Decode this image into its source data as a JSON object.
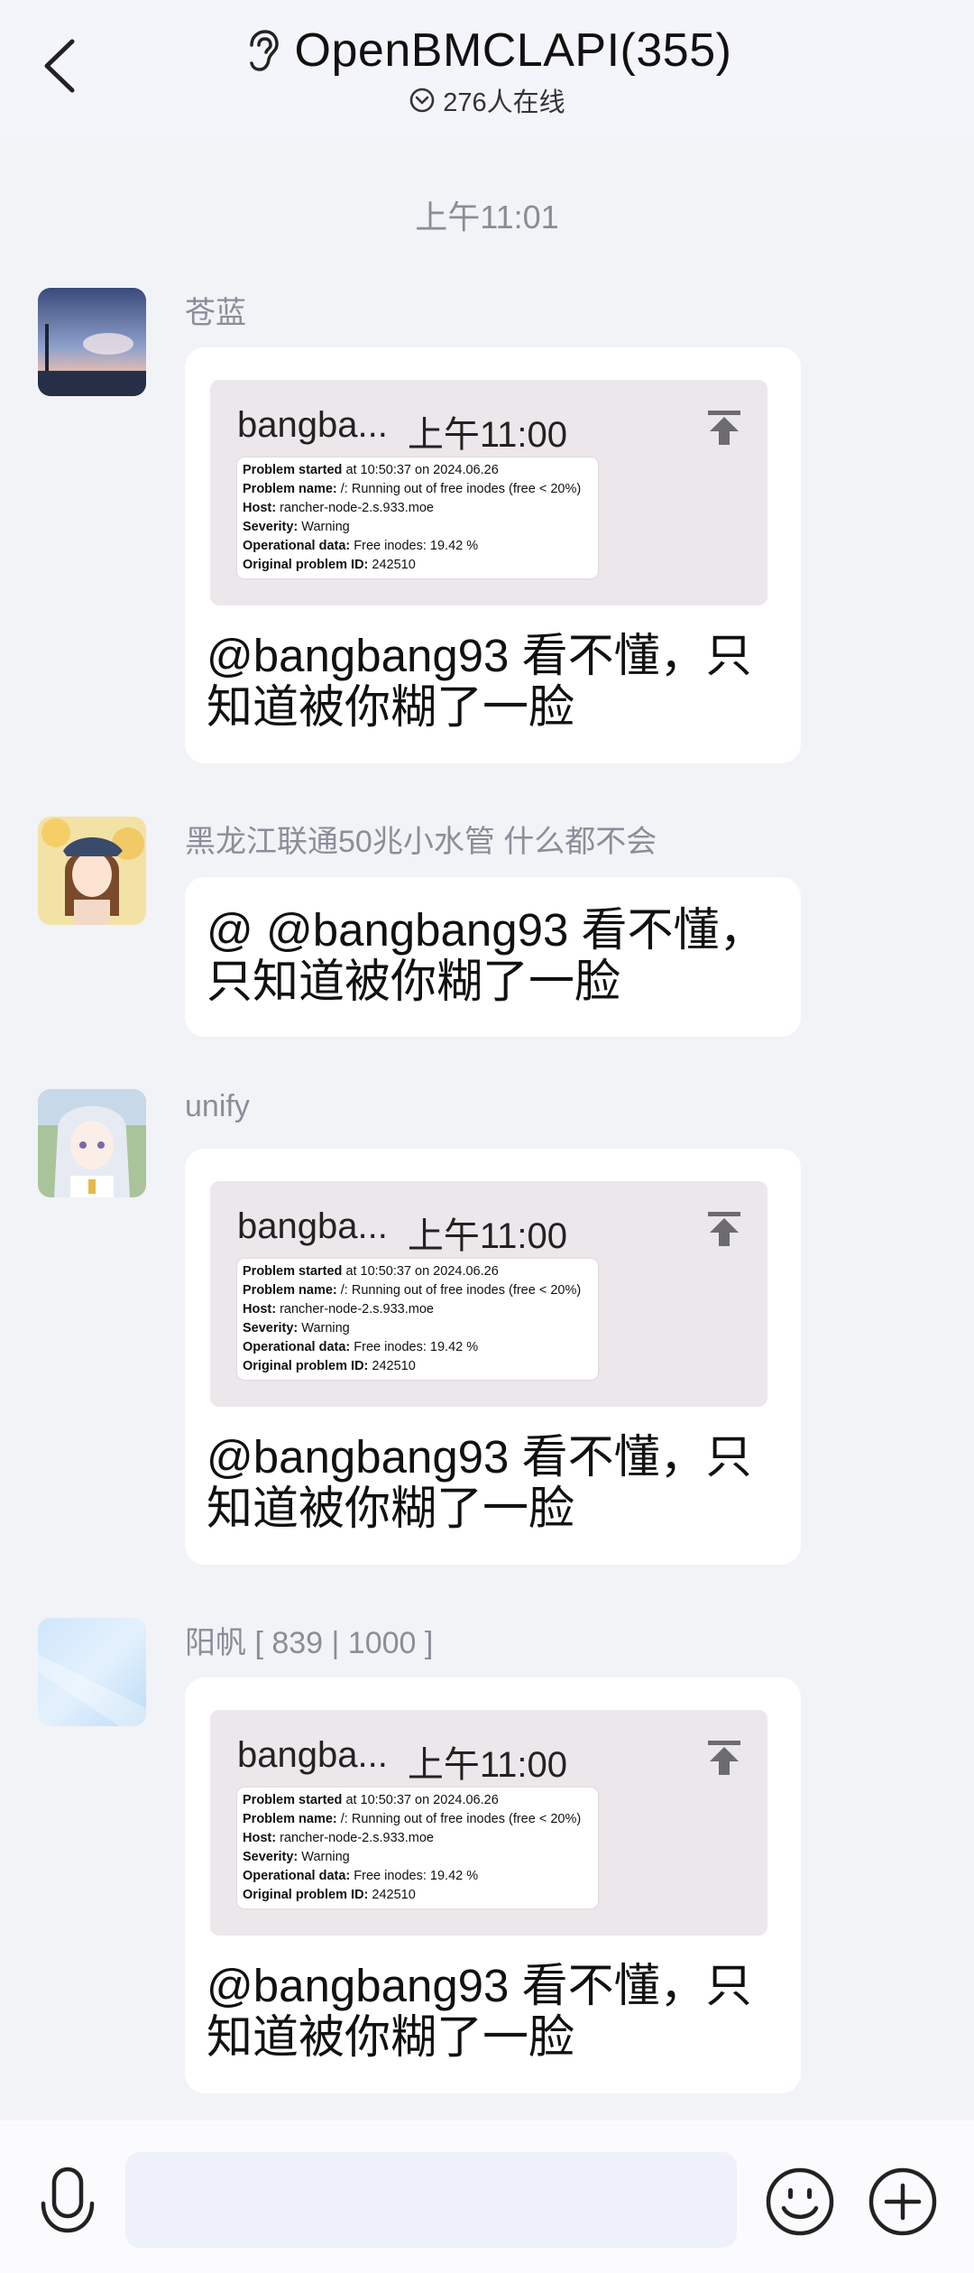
{
  "header": {
    "title": "OpenBMCLAPI(355)",
    "subtitle": "276人在线",
    "icons": [
      "back-icon",
      "ear-icon",
      "online-check-icon"
    ]
  },
  "chat": {
    "time_divider": "上午11:01",
    "messages": [
      {
        "sender": "苍蓝",
        "quote": {
          "author": "bangba...",
          "time": "上午11:00",
          "image_lines": [
            {
              "label": "Problem started",
              "value": "at 10:50:37 on 2024.06.26"
            },
            {
              "label": "Problem name:",
              "value": "/: Running out of free inodes (free < 20%)"
            },
            {
              "label": "Host:",
              "value": "rancher-node-2.s.933.moe"
            },
            {
              "label": "Severity:",
              "value": "Warning"
            },
            {
              "label": "Operational data:",
              "value": "Free inodes: 19.42 %"
            },
            {
              "label": "Original problem ID:",
              "value": "242510"
            }
          ]
        },
        "text": "@bangbang93 看不懂，只知道被你糊了一脸"
      },
      {
        "sender": "黑龙江联通50兆小水管 什么都不会",
        "text": "@ @bangbang93 看不懂，只知道被你糊了一脸"
      },
      {
        "sender": "unify",
        "quote": {
          "author": "bangba...",
          "time": "上午11:00",
          "image_lines": [
            {
              "label": "Problem started",
              "value": "at 10:50:37 on 2024.06.26"
            },
            {
              "label": "Problem name:",
              "value": "/: Running out of free inodes (free < 20%)"
            },
            {
              "label": "Host:",
              "value": "rancher-node-2.s.933.moe"
            },
            {
              "label": "Severity:",
              "value": "Warning"
            },
            {
              "label": "Operational data:",
              "value": "Free inodes: 19.42 %"
            },
            {
              "label": "Original problem ID:",
              "value": "242510"
            }
          ]
        },
        "text": "@bangbang93 看不懂，只知道被你糊了一脸"
      },
      {
        "sender": "阳帆 [ 839 | 1000 ]",
        "quote": {
          "author": "bangba...",
          "time": "上午11:00",
          "image_lines": [
            {
              "label": "Problem started",
              "value": "at 10:50:37 on 2024.06.26"
            },
            {
              "label": "Problem name:",
              "value": "/: Running out of free inodes (free < 20%)"
            },
            {
              "label": "Host:",
              "value": "rancher-node-2.s.933.moe"
            },
            {
              "label": "Severity:",
              "value": "Warning"
            },
            {
              "label": "Operational data:",
              "value": "Free inodes: 19.42 %"
            },
            {
              "label": "Original problem ID:",
              "value": "242510"
            }
          ]
        },
        "text": "@bangbang93 看不懂，只知道被你糊了一脸"
      }
    ]
  },
  "input_bar": {
    "value": "",
    "icons": [
      "microphone-icon",
      "emoji-icon",
      "plus-icon"
    ]
  },
  "colors": {
    "background": "#f2f3f7",
    "bubble": "#ffffff",
    "quote_bg": "#ebe7ea",
    "meta_text": "#8b8e98"
  }
}
